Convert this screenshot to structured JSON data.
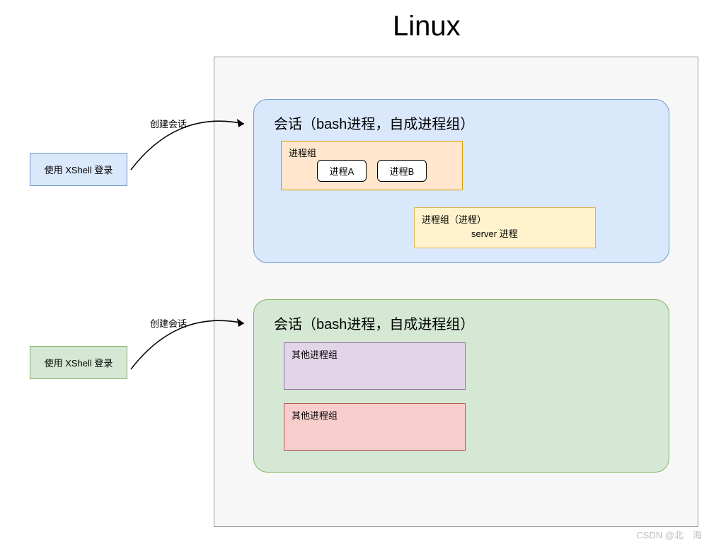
{
  "title": "Linux",
  "xshell_login_1": "使用 XShell 登录",
  "xshell_login_2": "使用 XShell 登录",
  "create_session_1": "创建会话",
  "create_session_2": "创建会话",
  "session_1": {
    "title": "会话（bash进程，自成进程组）",
    "proc_group_label": "进程组",
    "proc_a": "进程A",
    "proc_b": "进程B",
    "proc_group_2_label": "进程组（进程）",
    "server_proc": "server 进程"
  },
  "session_2": {
    "title": "会话（bash进程，自成进程组）",
    "other_group_1": "其他进程组",
    "other_group_2": "其他进程组"
  },
  "watermark": "CSDN @北　海"
}
